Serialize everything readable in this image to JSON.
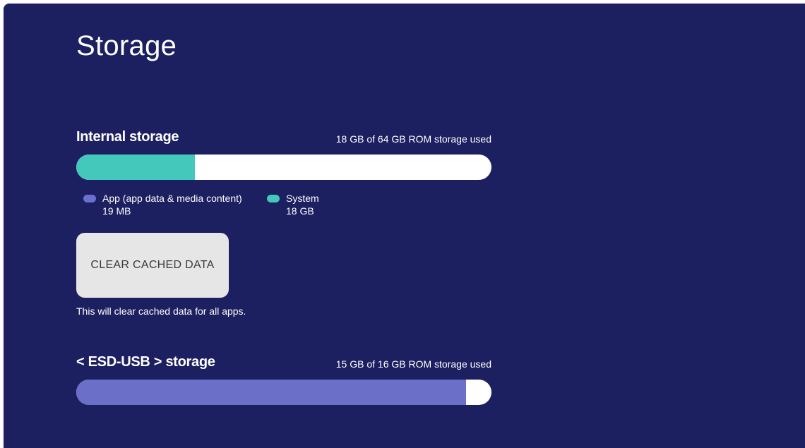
{
  "page": {
    "title": "Storage"
  },
  "internal": {
    "title": "Internal storage",
    "used_text": "18 GB of 64 GB ROM storage used",
    "used_fraction": 0.285,
    "fill_color": "#44c8bb",
    "legend": [
      {
        "label": "App (app data & media content)",
        "value": "19 MB",
        "color": "#6b6fd0"
      },
      {
        "label": "System",
        "value": "18 GB",
        "color": "#44c8bb"
      }
    ]
  },
  "clear_cache": {
    "button_label": "CLEAR CACHED DATA",
    "hint": "This will clear cached data for all apps."
  },
  "usb": {
    "title": "< ESD-USB > storage",
    "used_text": "15 GB of 16 GB ROM storage used",
    "used_fraction": 0.938,
    "fill_color": "#6b6fc7"
  }
}
